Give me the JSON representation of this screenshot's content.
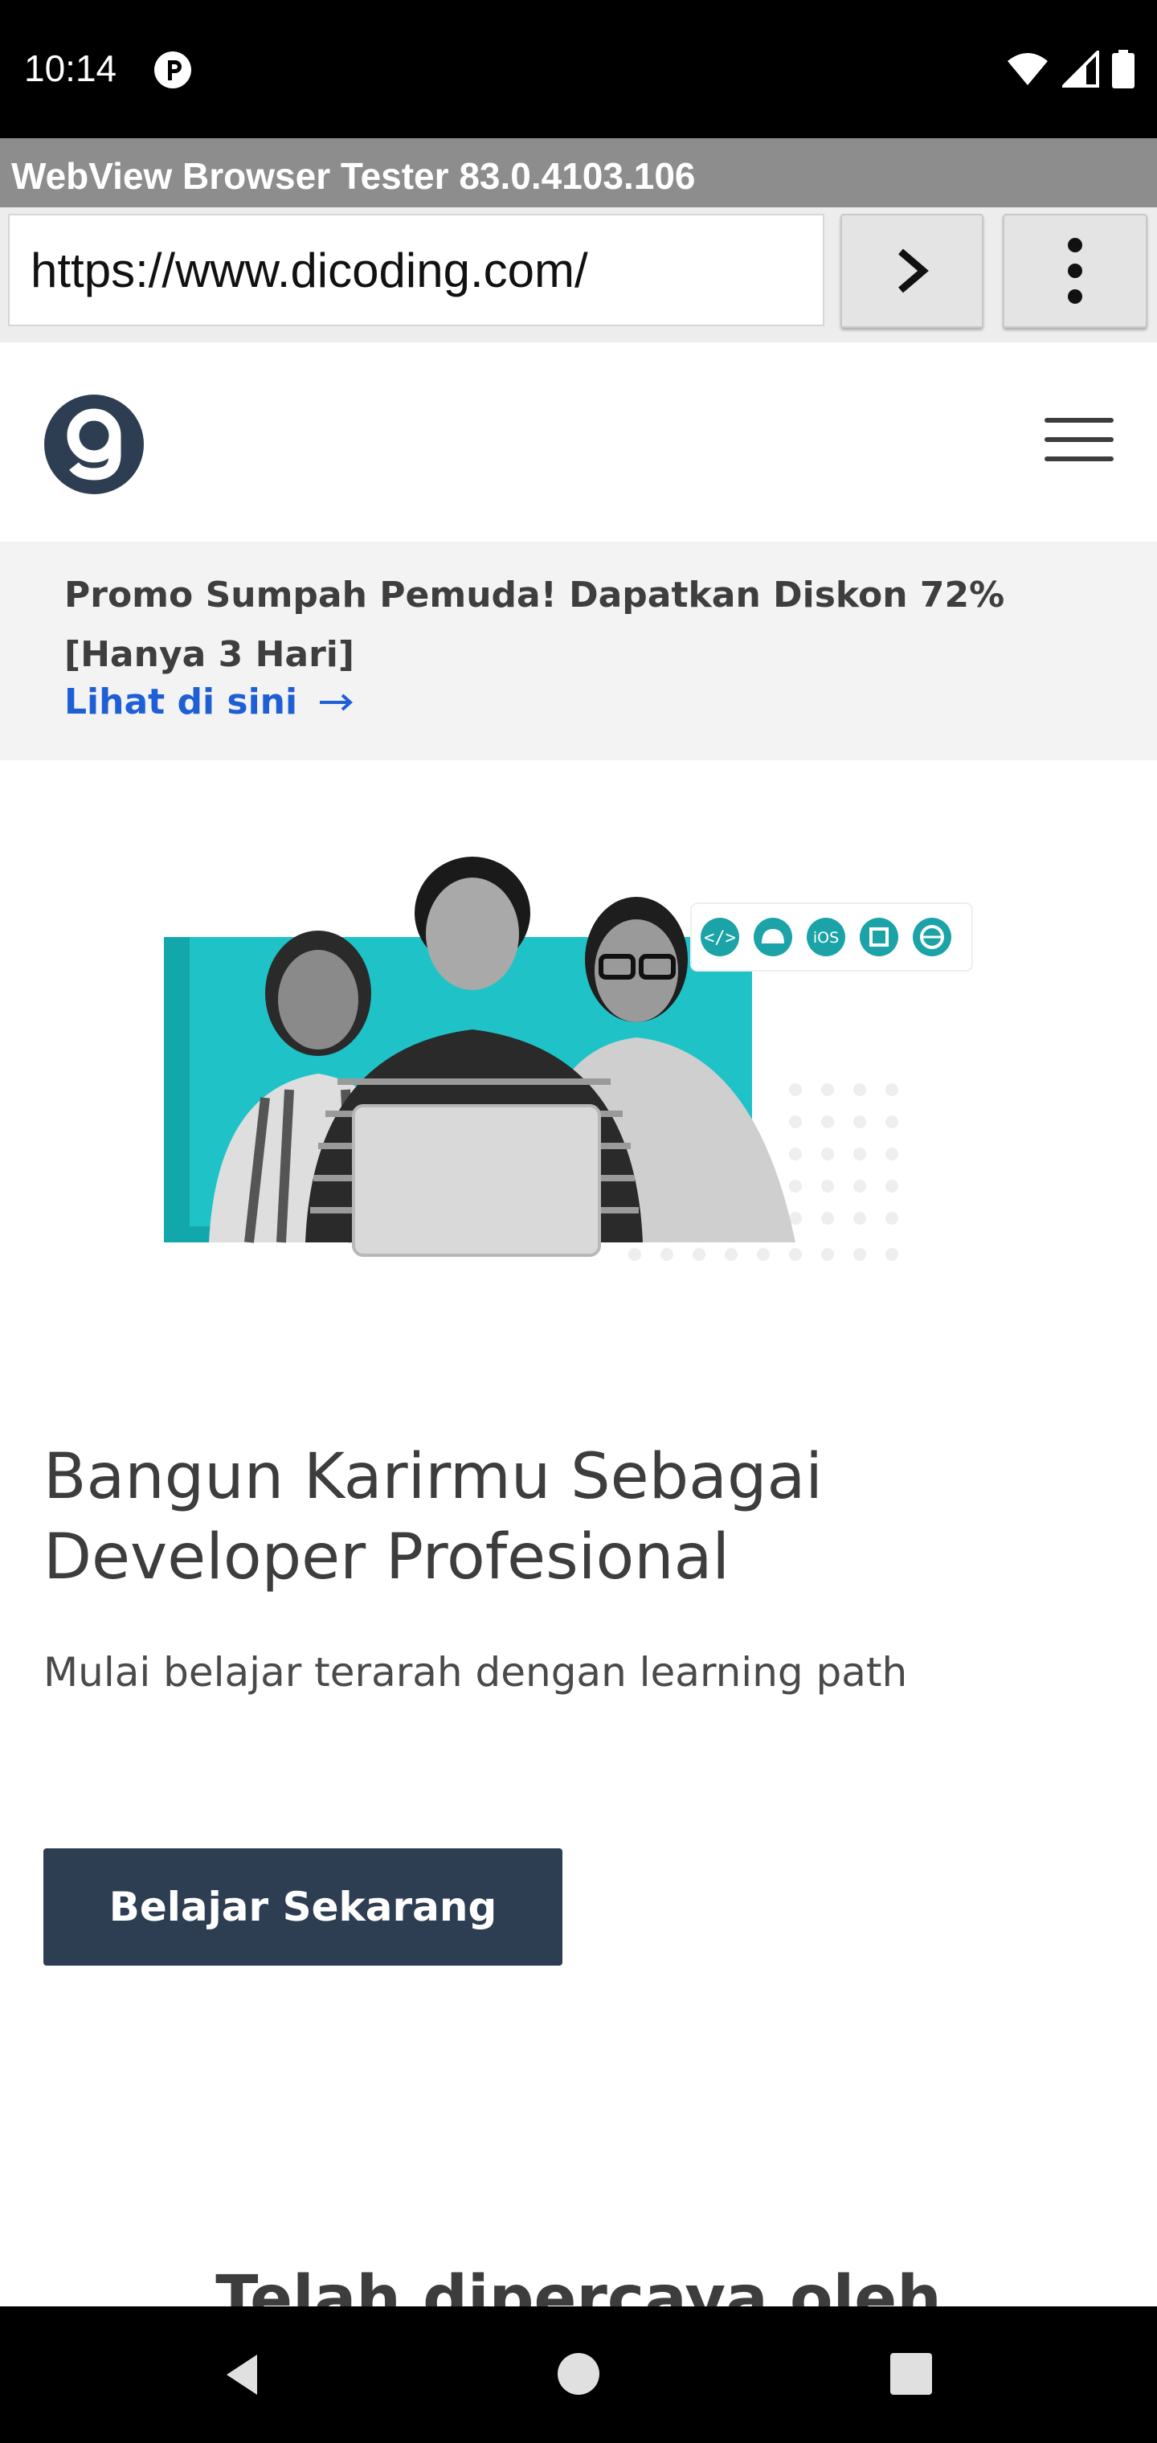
{
  "status_bar": {
    "time": "10:14",
    "app_icon": "circle-p-icon",
    "icons": [
      "wifi-icon",
      "signal-icon",
      "battery-icon"
    ]
  },
  "tester": {
    "title": "WebView Browser Tester 83.0.4103.106",
    "url": "https://www.dicoding.com/",
    "go_icon": "chevron-right-icon",
    "more_icon": "more-vertical-icon"
  },
  "header": {
    "logo_icon": "dicoding-logo-icon",
    "menu_icon": "hamburger-menu-icon"
  },
  "promo": {
    "text": "Promo Sumpah Pemuda! Dapatkan Diskon 72% [Hanya 3 Hari]",
    "link_label": "Lihat di sini",
    "link_icon": "arrow-right-icon"
  },
  "hero": {
    "illustration": "hero-people-illustration",
    "badge_icons": [
      "code-icon",
      "android-icon",
      "ios-icon",
      "chip-icon",
      "globe-icon"
    ],
    "badge_ios_text": "iOS",
    "title": "Bangun Karirmu Sebagai Developer Profesional",
    "subtitle": "Mulai belajar terarah dengan learning path",
    "cta_label": "Belajar Sekarang"
  },
  "trusted": {
    "heading": "Telah dipercaya oleh"
  },
  "nav_bar": {
    "icons": [
      "back-icon",
      "home-icon",
      "recents-icon"
    ]
  },
  "colors": {
    "brand_dark": "#2e3e52",
    "link_blue": "#1f5fd6",
    "teal": "#1fc3c7"
  }
}
